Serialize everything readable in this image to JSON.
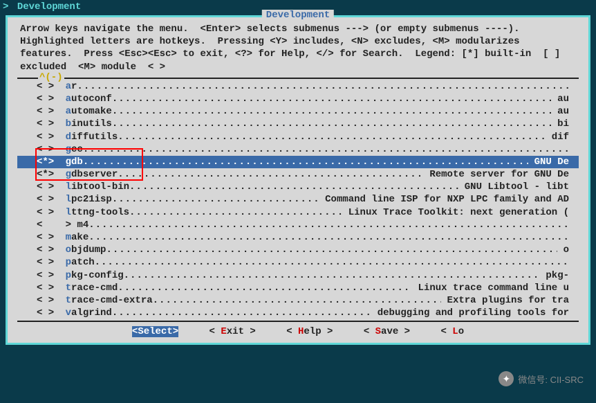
{
  "breadcrumb": {
    "prompt": ">",
    "path": "Development"
  },
  "outer": {
    "title": "Development"
  },
  "help": "Arrow keys navigate the menu.  <Enter> selects submenus ---> (or empty submenus ----).  Highlighted letters are hotkeys.  Pressing <Y> includes, <N> excludes, <M> modularizes features.  Press <Esc><Esc> to exit, <?> for Help, </> for Search.  Legend: [*] built-in  [ ] excluded  <M> module  < >",
  "scroll_marker": "^(-)",
  "items": [
    {
      "state": "< >",
      "hot": "a",
      "name": "r",
      "desc": ""
    },
    {
      "state": "< >",
      "hot": "a",
      "name": "utoconf",
      "desc": " au"
    },
    {
      "state": "< >",
      "hot": "a",
      "name": "utomake",
      "desc": " au"
    },
    {
      "state": "< >",
      "hot": "b",
      "name": "inutils",
      "desc": " bi"
    },
    {
      "state": "< >",
      "hot": "d",
      "name": "iffutils",
      "desc": " dif"
    },
    {
      "state": "< >",
      "hot": "g",
      "name": "cc",
      "desc": ""
    },
    {
      "state": "<*>",
      "hot": "g",
      "name": "db",
      "desc": " GNU De",
      "selected": true
    },
    {
      "state": "<*>",
      "hot": "g",
      "name": "dbserver",
      "desc": " Remote server for GNU De"
    },
    {
      "state": "< >",
      "hot": "l",
      "name": "ibtool-bin",
      "desc": " GNU Libtool - libt"
    },
    {
      "state": "< >",
      "hot": "l",
      "name": "pc21isp",
      "desc": " Command line ISP for NXP LPC family and AD"
    },
    {
      "state": "< >",
      "hot": "l",
      "name": "ttng-tools",
      "desc": " Linux Trace Toolkit: next generation ("
    },
    {
      "state": "<  ",
      "hot": "",
      "name": "> m4",
      "desc": ""
    },
    {
      "state": "< >",
      "hot": "m",
      "name": "ake",
      "desc": ""
    },
    {
      "state": "< >",
      "hot": "o",
      "name": "bjdump",
      "desc": " o"
    },
    {
      "state": "< >",
      "hot": "p",
      "name": "atch",
      "desc": ""
    },
    {
      "state": "< >",
      "hot": "p",
      "name": "kg-config",
      "desc": " pkg-"
    },
    {
      "state": "< >",
      "hot": "t",
      "name": "race-cmd",
      "desc": " Linux trace command line u"
    },
    {
      "state": "< >",
      "hot": "t",
      "name": "race-cmd-extra",
      "desc": " Extra plugins for tra"
    },
    {
      "state": "< >",
      "hot": "v",
      "name": "algrind",
      "desc": " debugging and profiling tools for"
    }
  ],
  "buttons": {
    "select": {
      "bl": "<",
      "hot": "S",
      "rest": "elect",
      "br": ">"
    },
    "exit": {
      "bl": "<",
      "hot": " E",
      "rest": "xit ",
      "br": ">"
    },
    "help": {
      "bl": "<",
      "hot": " H",
      "rest": "elp ",
      "br": ">"
    },
    "save": {
      "bl": "<",
      "hot": " S",
      "rest": "ave ",
      "br": ">"
    },
    "load": {
      "bl": "<",
      "hot": " L",
      "rest": "o",
      "br": ""
    }
  },
  "watermark": {
    "label": "微信号: CII-SRC"
  }
}
